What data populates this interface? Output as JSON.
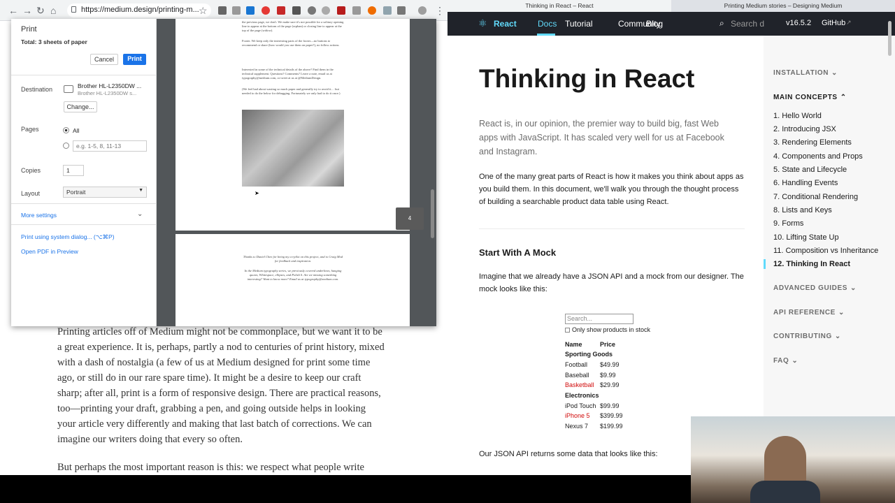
{
  "left_browser": {
    "url": "https://medium.design/printing-m...",
    "nav": [
      "←",
      "→",
      "↻",
      "⌂"
    ]
  },
  "print_dialog": {
    "title": "Print",
    "total": "Total: 3 sheets of paper",
    "cancel": "Cancel",
    "print": "Print",
    "destination_label": "Destination",
    "printer_name": "Brother HL-L2350DW ...",
    "printer_sub": "Brother HL-L2350DW s...",
    "change": "Change...",
    "pages_label": "Pages",
    "pages_all": "All",
    "pages_placeholder": "e.g. 1-5, 8, 11-13",
    "copies_label": "Copies",
    "copies_value": "1",
    "layout_label": "Layout",
    "layout_value": "Portrait",
    "more_settings": "More settings",
    "system_dialog": "Print using system dialog... (⌥⌘P)",
    "open_pdf": "Open PDF in Preview",
    "page_badge": "4"
  },
  "preview": {
    "para1": "the previous page, we don't. We make sure it's not possible for a solitary opening line to appear at the bottom of the page (orphan) or closing line to appear at the top of the page (widow).",
    "para2": "Footer. We keep only the interesting parts of the footer—no buttons to recommend or share (how would you use them on paper?), no follow actions.",
    "para3": "Interested in some of the technical details of the above? Find them in the technical supplement. Questions? Comments? Leave a note, email us at typography@medium.com, or tweet at us at @MediumDesign.",
    "para4": "(We feel bad about wasting so much paper and generally try to avoid it… but needed to do the below for debugging. Fortunately we only had to do it once.)",
    "page2_para1": "Thanks to Daniel Chen for being my co-pilot on this project, and to Craig Mod for feedback and inspiration.",
    "page2_para2": "In the Medium typography series, we previously covered underlines, hanging quotes, Whitespace, ellipses, and Polish S. Are we missing something interesting? Want to know more? Email us at typography@medium.com."
  },
  "article": {
    "p1": "Printing articles off of Medium might not be commonplace, but we want it to be a great experience. It is, perhaps, partly a nod to centuries of print history, mixed with a dash of nostalgia (a few of us at Medium designed for print some time ago, or still do in our rare spare time). It might be a desire to keep our craft sharp; after all, print is a form of responsive design. There are practical reasons, too—printing your draft, grabbing a pen, and going outside helps in looking your article very differently and making that last batch of corrections. We can imagine our writers doing that every so often.",
    "p2": "But perhaps the most important reason is this: we respect what people write"
  },
  "right_browser": {
    "tab1": "Thinking in React – React",
    "tab2": "Printing Medium stories – Designing Medium",
    "brand": "React",
    "nav": [
      "Docs",
      "Tutorial",
      "Community",
      "Blog"
    ],
    "search_placeholder": "Search d",
    "version": "v16.5.2",
    "github": "GitHub"
  },
  "docs": {
    "title": "Thinking in React",
    "lead": "React is, in our opinion, the premier way to build big, fast Web apps with JavaScript. It has scaled very well for us at Facebook and Instagram.",
    "intro": "One of the many great parts of React is how it makes you think about apps as you build them. In this document, we'll walk you through the thought process of building a searchable product data table using React.",
    "h2": "Start With A Mock",
    "mock_text": "Imagine that we already have a JSON API and a mock from our designer. The mock looks like this:",
    "json_text": "Our JSON API returns some data that looks like this:"
  },
  "mock": {
    "search_placeholder": "Search...",
    "checkbox_label": "Only show products in stock",
    "col_name": "Name",
    "col_price": "Price",
    "cat1": "Sporting Goods",
    "cat2": "Electronics",
    "rows1": [
      [
        "Football",
        "$49.99"
      ],
      [
        "Baseball",
        "$9.99"
      ],
      [
        "Basketball",
        "$29.99"
      ]
    ],
    "rows2": [
      [
        "iPod Touch",
        "$99.99"
      ],
      [
        "iPhone 5",
        "$399.99"
      ],
      [
        "Nexus 7",
        "$199.99"
      ]
    ]
  },
  "sidebar": {
    "installation": "INSTALLATION",
    "main_concepts": "MAIN CONCEPTS",
    "items": [
      "1. Hello World",
      "2. Introducing JSX",
      "3. Rendering Elements",
      "4. Components and Props",
      "5. State and Lifecycle",
      "6. Handling Events",
      "7. Conditional Rendering",
      "8. Lists and Keys",
      "9. Forms",
      "10. Lifting State Up",
      "11. Composition vs Inheritance",
      "12. Thinking In React"
    ],
    "advanced": "ADVANCED GUIDES",
    "api": "API REFERENCE",
    "contributing": "CONTRIBUTING",
    "faq": "FAQ"
  },
  "colors": {
    "react_blue": "#61dafb",
    "react_dark": "#20232a",
    "chrome_blue": "#1a73e8",
    "active_red": "#d10a0a"
  }
}
